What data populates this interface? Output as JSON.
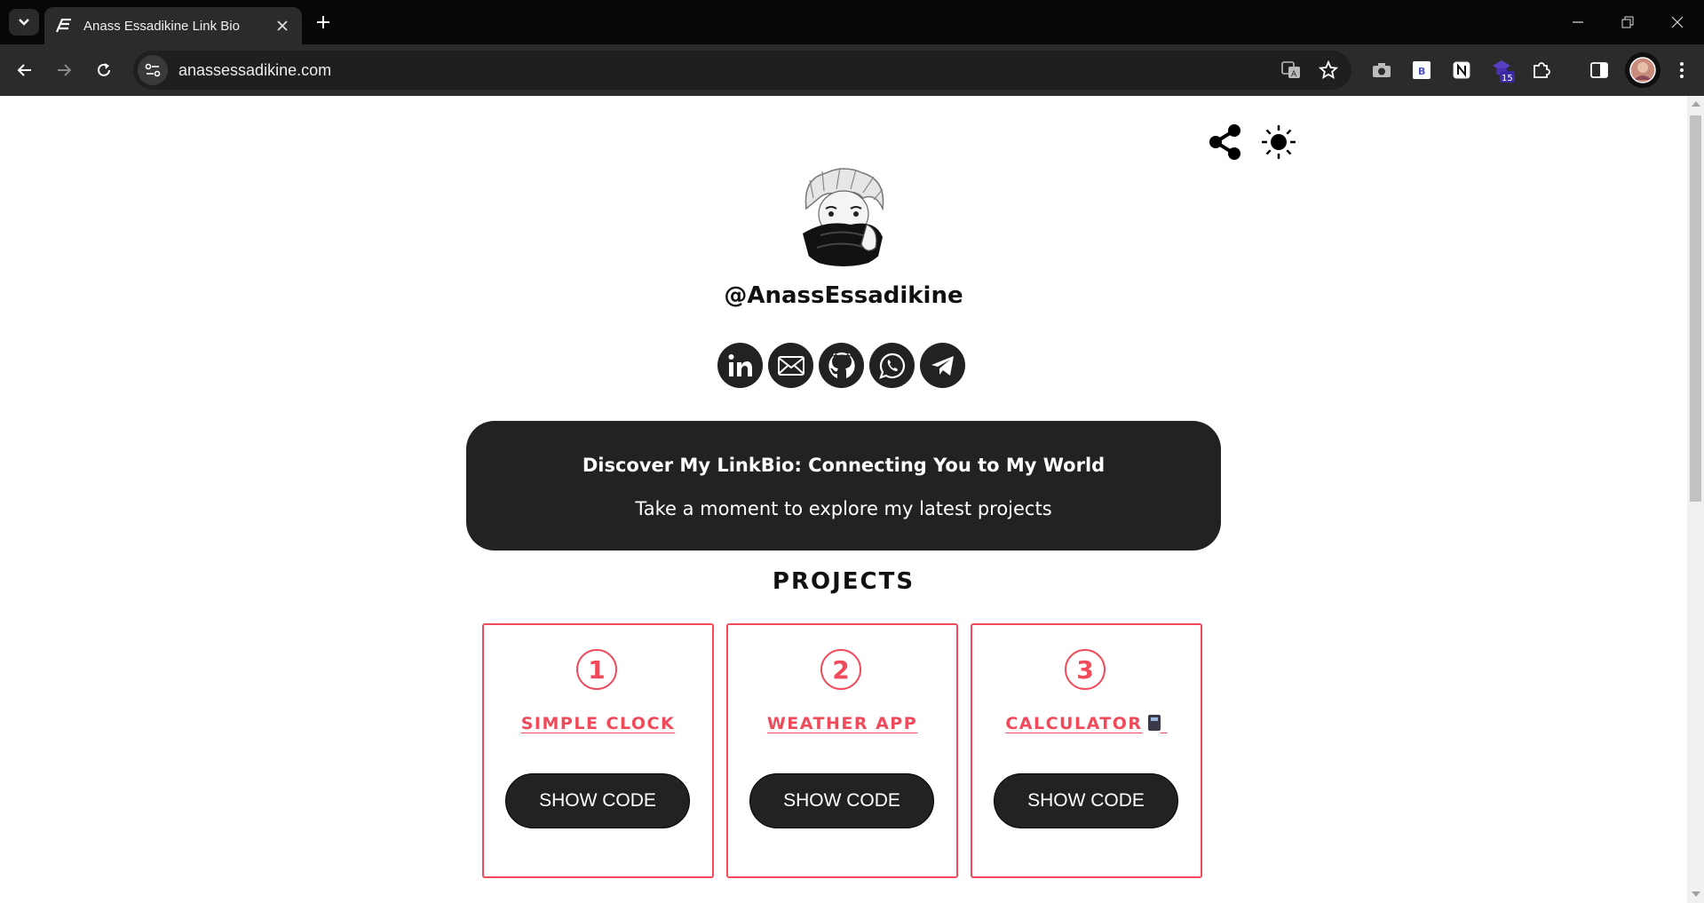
{
  "browser": {
    "tab_title": "Anass Essadikine Link Bio",
    "url": "anassessadikine.com",
    "extension_badge": "15"
  },
  "page": {
    "username": "@AnassEssadikine",
    "socials": [
      {
        "name": "linkedin-icon"
      },
      {
        "name": "email-icon"
      },
      {
        "name": "github-icon"
      },
      {
        "name": "whatsapp-icon"
      },
      {
        "name": "telegram-icon"
      }
    ],
    "hero": {
      "title": "Discover My LinkBio: Connecting You to My World",
      "subtitle": "Take a moment to explore my latest projects"
    },
    "projects_heading": "PROJECTS",
    "projects": [
      {
        "number": "1",
        "title": "SIMPLE CLOCK",
        "button": "SHOW CODE"
      },
      {
        "number": "2",
        "title": "WEATHER APP",
        "button": "SHOW CODE"
      },
      {
        "number": "3",
        "title": "CALCULATOR",
        "button": "SHOW CODE"
      }
    ]
  },
  "colors": {
    "accent": "#f04a5b",
    "dark": "#222222",
    "chrome_bg": "#070707",
    "toolbar_bg": "#2b2b2b"
  }
}
